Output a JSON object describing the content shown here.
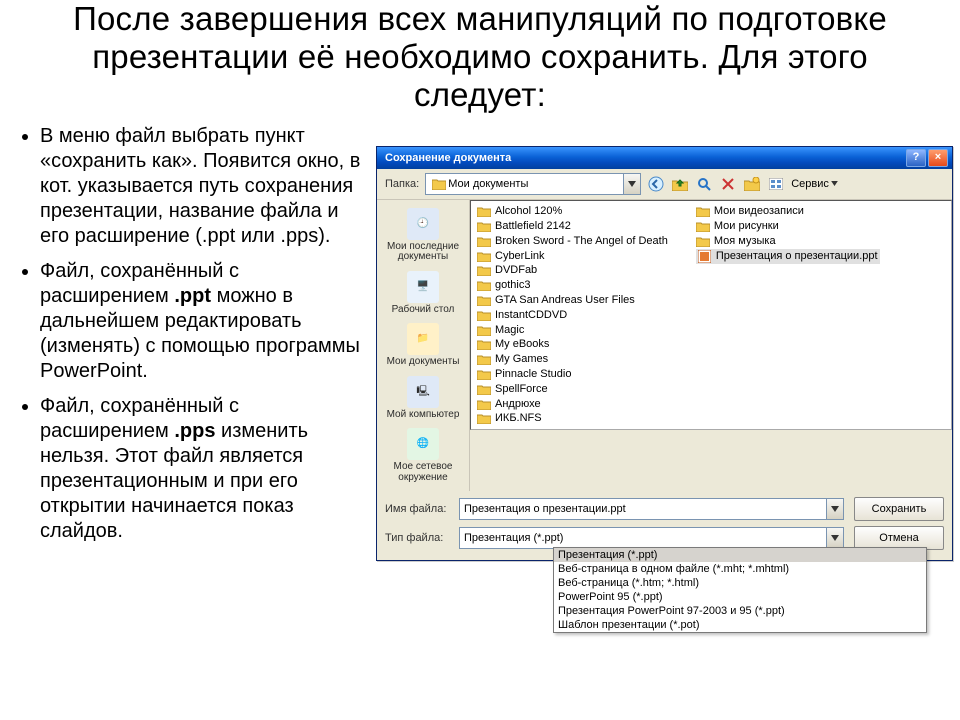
{
  "slide": {
    "title": "После завершения всех манипуляций по подготовке презентации её необходимо сохранить. Для этого следует:",
    "bullets": [
      {
        "pre": "В меню файл выбрать пункт «сохранить как». Появится окно, в кот. указывается путь сохранения презентации, название файла и его расширение (.ppt или .pps).",
        "bold": "",
        "post": ""
      },
      {
        "pre": "Файл, сохранённый с расширением ",
        "bold": ".ppt",
        "post": " можно в дальнейшем редактировать (изменять) с помощью программы PowerPoint."
      },
      {
        "pre": "Файл, сохранённый с расширением ",
        "bold": ".pps",
        "post": " изменить нельзя. Этот файл является презентационным и при его открытии начинается показ слайдов."
      }
    ]
  },
  "dialog": {
    "title": "Сохранение документа",
    "helpGlyph": "?",
    "closeGlyph": "×",
    "folderLabel": "Папка:",
    "currentFolder": "Мои документы",
    "service": "Сервис",
    "places": [
      {
        "label": "Мои последние документы",
        "icon": "recent-icon",
        "bg": "#dfe9f7",
        "glyph": "🕘"
      },
      {
        "label": "Рабочий стол",
        "icon": "desktop-icon",
        "bg": "#e9f2fb",
        "glyph": "🖥️"
      },
      {
        "label": "Мои документы",
        "icon": "my-documents-icon",
        "bg": "#fff1c8",
        "glyph": "📁"
      },
      {
        "label": "Мой компьютер",
        "icon": "my-computer-icon",
        "bg": "#dfe9f7",
        "glyph": "🖳"
      },
      {
        "label": "Мое сетевое окружение",
        "icon": "network-icon",
        "bg": "#e3f6e4",
        "glyph": "🌐"
      }
    ],
    "listing": {
      "col1": [
        {
          "name": "Alcohol 120%",
          "type": "folder"
        },
        {
          "name": "Battlefield 2142",
          "type": "folder"
        },
        {
          "name": "Broken Sword - The Angel of Death",
          "type": "folder"
        },
        {
          "name": "CyberLink",
          "type": "folder"
        },
        {
          "name": "DVDFab",
          "type": "folder"
        },
        {
          "name": "gothic3",
          "type": "folder"
        },
        {
          "name": "GTA San Andreas User Files",
          "type": "folder"
        },
        {
          "name": "InstantCDDVD",
          "type": "folder"
        },
        {
          "name": "Magic",
          "type": "folder"
        },
        {
          "name": "My eBooks",
          "type": "folder"
        },
        {
          "name": "My Games",
          "type": "folder"
        },
        {
          "name": "Pinnacle Studio",
          "type": "folder"
        },
        {
          "name": "SpellForce",
          "type": "folder"
        },
        {
          "name": "Андрюхе",
          "type": "folder"
        },
        {
          "name": "ИКБ.NFS",
          "type": "folder"
        }
      ],
      "col2": [
        {
          "name": "Мои видеозаписи",
          "type": "folder"
        },
        {
          "name": "Мои рисунки",
          "type": "folder"
        },
        {
          "name": "Моя музыка",
          "type": "folder"
        },
        {
          "name": "Презентация о презентации.ppt",
          "type": "ppt",
          "selected": true
        }
      ]
    },
    "filenameLabel": "Имя файла:",
    "filenameValue": "Презентация о презентации.ppt",
    "filetypeLabel": "Тип файла:",
    "filetypeValue": "Презентация (*.ppt)",
    "saveBtn": "Сохранить",
    "cancelBtn": "Отмена",
    "typeOptions": [
      "Презентация (*.ppt)",
      "Веб-страница в одном файле (*.mht; *.mhtml)",
      "Веб-страница (*.htm; *.html)",
      "PowerPoint 95 (*.ppt)",
      "Презентация PowerPoint 97-2003 и 95 (*.ppt)",
      "Шаблон презентации (*.pot)"
    ]
  }
}
